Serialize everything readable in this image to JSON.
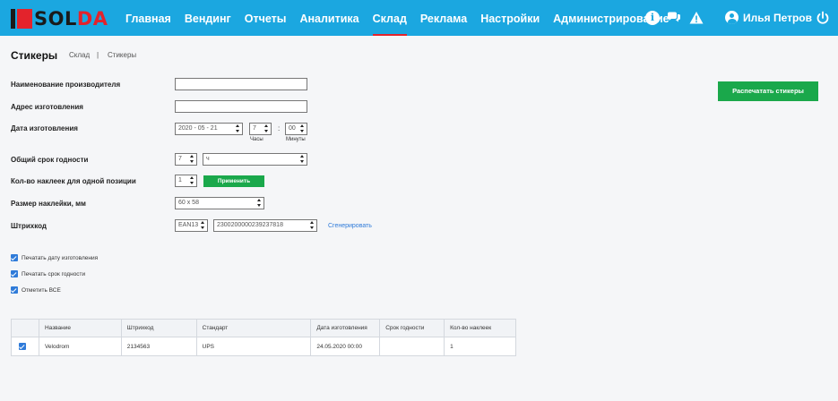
{
  "header": {
    "logo": {
      "part1": "SOL",
      "part2": "DA"
    },
    "nav": [
      {
        "label": "Главная",
        "active": false
      },
      {
        "label": "Вендинг",
        "active": false
      },
      {
        "label": "Отчеты",
        "active": false
      },
      {
        "label": "Аналитика",
        "active": false
      },
      {
        "label": "Склад",
        "active": true
      },
      {
        "label": "Реклама",
        "active": false
      },
      {
        "label": "Настройки",
        "active": false
      },
      {
        "label": "Администрирование",
        "active": false
      }
    ],
    "icons": {
      "info": "i",
      "chat": "chat-icon",
      "warning": "warning-icon",
      "power": "power-icon"
    },
    "user_name": "Илья Петров"
  },
  "page": {
    "title": "Стикеры",
    "breadcrumb": [
      "Склад",
      "|",
      "Стикеры"
    ]
  },
  "form": {
    "manufacturer_label": "Наименование производителя",
    "manufacturer_value": "",
    "address_label": "Адрес изготовления",
    "address_value": "",
    "date_label": "Дата изготовления",
    "date_value": "2020 - 05 - 21",
    "hours_value": "7",
    "hours_label": "Часы",
    "minutes_value": "00",
    "minutes_label": "Минуты",
    "time_separator": ":",
    "shelf_label": "Общий срок годности",
    "shelf_value": "7",
    "shelf_unit": "ч",
    "count_label": "Кол-во наклеек для одной позиции",
    "count_value": "1",
    "apply_button": "Применить",
    "size_label": "Размер наклейки, мм",
    "size_value": "60 x 58",
    "barcode_label": "Штрихкод",
    "barcode_type": "EAN13",
    "barcode_value": "2300200000239237818",
    "generate_link": "Сгенерировать",
    "print_button": "Распечатать стикеры"
  },
  "options": [
    {
      "label": "Печатать дату изготовления",
      "checked": true
    },
    {
      "label": "Печатать срок годности",
      "checked": true
    },
    {
      "label": "Отметить ВСЕ",
      "checked": true
    }
  ],
  "table": {
    "headers": [
      "Название",
      "Штрихкод",
      "Стандарт",
      "Дата изготовления",
      "Срок годности",
      "Кол-во наклеек"
    ],
    "rows": [
      {
        "checked": true,
        "cells": [
          "Velodrom",
          "2134563",
          "UPS",
          "24.05.2020 00:00",
          "",
          "1"
        ]
      }
    ]
  },
  "colors": {
    "header_bg": "#1ba7e0",
    "accent_red": "#e3232c",
    "green": "#1aa84b",
    "link_blue": "#2f7bd9"
  }
}
